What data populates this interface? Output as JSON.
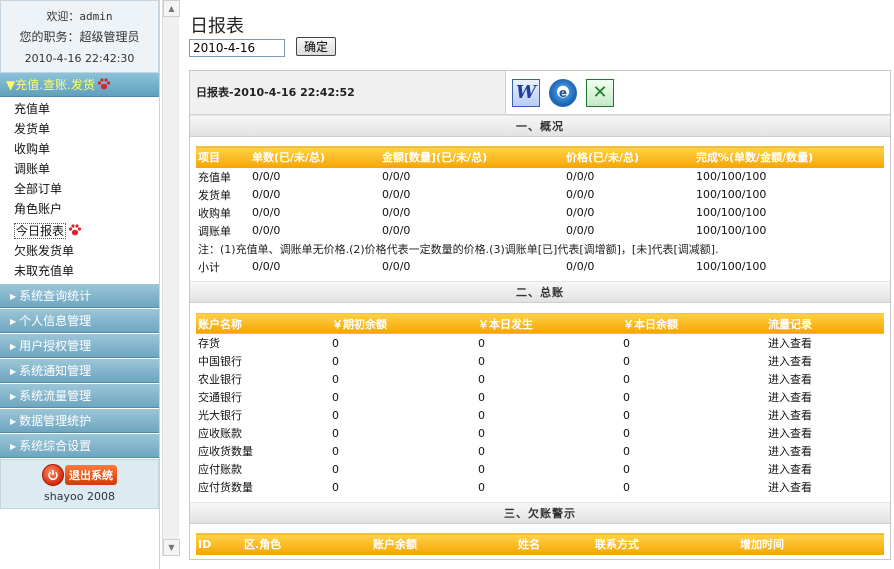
{
  "sidebar": {
    "welcome": "欢迎：admin",
    "role": "您的职务：超级管理员",
    "time": "2010-4-16 22:42:30",
    "open_menu": {
      "label": "充值.查账.发货",
      "items": [
        {
          "label": "充值单"
        },
        {
          "label": "发货单"
        },
        {
          "label": "收购单"
        },
        {
          "label": "调账单"
        },
        {
          "label": "全部订单"
        },
        {
          "label": "角色账户"
        },
        {
          "label": "今日报表"
        },
        {
          "label": "欠账发货单"
        },
        {
          "label": "未取充值单"
        }
      ]
    },
    "closed_menus": [
      {
        "label": "系统查询统计"
      },
      {
        "label": "个人信息管理"
      },
      {
        "label": "用户授权管理"
      },
      {
        "label": "系统通知管理"
      },
      {
        "label": "系统流量管理"
      },
      {
        "label": "数据管理统护"
      },
      {
        "label": "系统综合设置"
      }
    ],
    "logout_label": "退出系统",
    "copyright": "shayoo 2008"
  },
  "main": {
    "title": "日报表",
    "date_value": "2010-4-16",
    "ok_label": "确定",
    "report_title": "日报表-2010-4-16 22:42:52",
    "export_icons": [
      "word-icon",
      "ie-icon",
      "excel-icon"
    ],
    "overview": {
      "heading": "一、概况",
      "headers": [
        "项目",
        "单数(已/未/总)",
        "金额[数量](已/未/总)",
        "价格(已/未/总)",
        "完成%(单数/金额/数量)"
      ],
      "rows": [
        [
          "充值单",
          "0/0/0",
          "0/0/0",
          "0/0/0",
          "100/100/100"
        ],
        [
          "发货单",
          "0/0/0",
          "0/0/0",
          "0/0/0",
          "100/100/100"
        ],
        [
          "收购单",
          "0/0/0",
          "0/0/0",
          "0/0/0",
          "100/100/100"
        ],
        [
          "调账单",
          "0/0/0",
          "0/0/0",
          "0/0/0",
          "100/100/100"
        ]
      ],
      "note": "注：(1)充值单、调账单无价格.(2)价格代表一定数量的价格.(3)调账单[已]代表[调增额]，[未]代表[调减额].",
      "subtotal": [
        "小计",
        "0/0/0",
        "0/0/0",
        "0/0/0",
        "100/100/100"
      ]
    },
    "ledger": {
      "heading": "二、总账",
      "headers": [
        "账户名称",
        "￥期初余额",
        "￥本日发生",
        "￥本日余额",
        "流量记录"
      ],
      "rows": [
        [
          "存货",
          "0",
          "0",
          "0",
          "进入查看"
        ],
        [
          "中国银行",
          "0",
          "0",
          "0",
          "进入查看"
        ],
        [
          "农业银行",
          "0",
          "0",
          "0",
          "进入查看"
        ],
        [
          "交通银行",
          "0",
          "0",
          "0",
          "进入查看"
        ],
        [
          "光大银行",
          "0",
          "0",
          "0",
          "进入查看"
        ],
        [
          "应收账款",
          "0",
          "0",
          "0",
          "进入查看"
        ],
        [
          "应收货数量",
          "0",
          "0",
          "0",
          "进入查看"
        ],
        [
          "应付账款",
          "0",
          "0",
          "0",
          "进入查看"
        ],
        [
          "应付货数量",
          "0",
          "0",
          "0",
          "进入查看"
        ]
      ]
    },
    "debt": {
      "heading": "三、欠账警示",
      "headers": [
        "ID",
        "区.角色",
        "账户余额",
        "姓名",
        "联系方式",
        "增加时间"
      ]
    }
  }
}
